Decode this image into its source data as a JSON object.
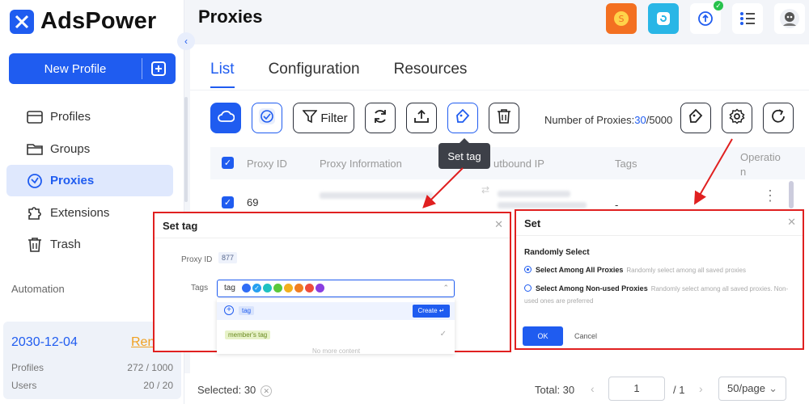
{
  "app": {
    "name": "AdsPower",
    "page_title": "Proxies"
  },
  "sidebar": {
    "new_profile": "New Profile",
    "items": [
      {
        "label": "Profiles",
        "icon": "profiles-icon",
        "active": false
      },
      {
        "label": "Groups",
        "icon": "folder-icon",
        "active": false
      },
      {
        "label": "Proxies",
        "icon": "proxy-icon",
        "active": true
      },
      {
        "label": "Extensions",
        "icon": "puzzle-icon",
        "active": false
      },
      {
        "label": "Trash",
        "icon": "trash-icon",
        "active": false
      }
    ],
    "automation": "Automation",
    "plan": {
      "date": "2030-12-04",
      "renew": "Ren",
      "profiles_label": "Profiles",
      "profiles_value": "272 / 1000",
      "users_label": "Users",
      "users_value": "20 / 20"
    }
  },
  "tabs": [
    "List",
    "Configuration",
    "Resources"
  ],
  "toolbar": {
    "filter": "Filter",
    "tooltip": "Set tag"
  },
  "proxy_count": {
    "label": "Number of Proxies:",
    "current": "30",
    "max": "/5000"
  },
  "table": {
    "columns": [
      "Proxy ID",
      "Proxy Information",
      "utbound IP",
      "Tags",
      "Operatio n"
    ],
    "rows": [
      {
        "id": "69",
        "tags": "-"
      }
    ]
  },
  "footer": {
    "selected": "Selected: 30",
    "total": "Total: 30",
    "page": "1",
    "of": "/ 1",
    "page_size": "50/page"
  },
  "set_tag_dialog": {
    "title": "Set tag",
    "proxy_id_label": "Proxy ID",
    "proxy_id": "877",
    "tags_label": "Tags",
    "input_value": "tag",
    "colors": [
      "#2f6df6",
      "#27a0f0",
      "#1fc2c2",
      "#5ac93c",
      "#f2b01e",
      "#f07e22",
      "#ee4c3c",
      "#8a3ee0"
    ],
    "new_tag": "tag",
    "create": "Create ↵",
    "existing_tag": "member's tag",
    "no_more": "No more content"
  },
  "set_dialog": {
    "title": "Set",
    "section": "Randomly Select",
    "option1": "Select Among All Proxies",
    "option1_desc": "Randomly select among all saved proxies",
    "option2": "Select Among Non-used Proxies",
    "option2_desc": "Randomly select among all saved proxies. Non-used ones are preferred",
    "ok": "OK",
    "cancel": "Cancel"
  },
  "colors": {
    "accent": "#1f5cf0",
    "highlight": "#e02020",
    "renew": "#f0a020"
  }
}
